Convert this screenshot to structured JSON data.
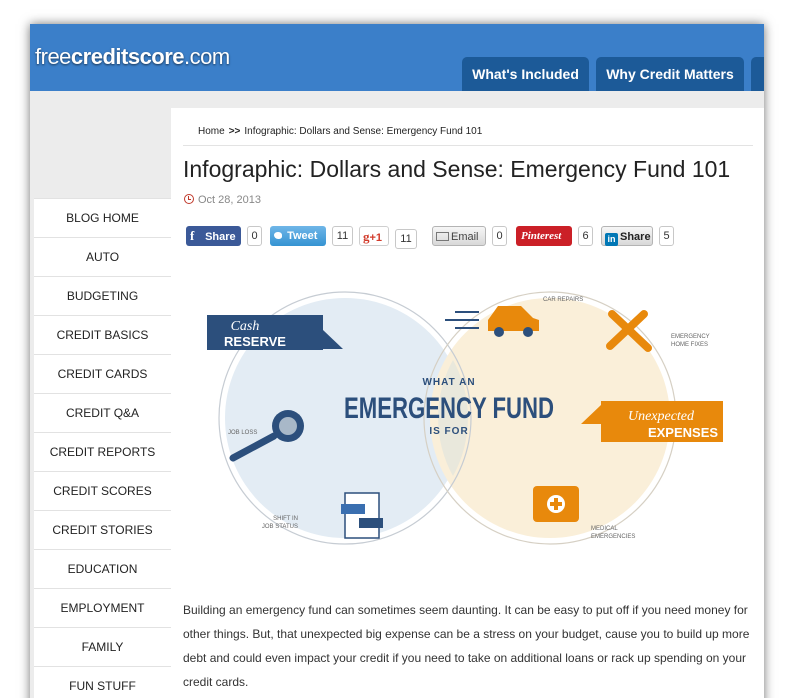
{
  "header": {
    "logo_pre": "free",
    "logo_bold": "creditscore",
    "logo_post": ".com",
    "tabs": [
      {
        "label": "What's Included"
      },
      {
        "label": "Why Credit Matters"
      }
    ]
  },
  "breadcrumb": {
    "home": "Home",
    "separator": ">>",
    "current": "Infographic: Dollars and Sense: Emergency Fund 101"
  },
  "article": {
    "title": "Infographic: Dollars and Sense: Emergency Fund 101",
    "date": "Oct 28, 2013",
    "body": "Building an emergency fund can sometimes seem daunting. It can be easy to put off if you need money for other things. But, that unexpected big expense can be a stress on your budget, cause you to build up more debt and could even impact your credit if you need to take on additional loans or rack up spending on your credit cards."
  },
  "share": {
    "facebook": {
      "label": "Share",
      "count": "0"
    },
    "twitter": {
      "label": "Tweet",
      "count": "11"
    },
    "gplus": {
      "label": "+1",
      "count": "11"
    },
    "email": {
      "label": "Email",
      "count": "0"
    },
    "pinterest": {
      "label": "Pinterest",
      "count": "6"
    },
    "linkedin": {
      "label": "Share",
      "count": "5"
    }
  },
  "infographic": {
    "cash_1": "Cash",
    "cash_2": "RESERVE",
    "what_an": "WHAT AN",
    "emergency_fund": "EMERGENCY FUND",
    "is_for": "IS FOR",
    "car_repairs": "CAR REPAIRS",
    "emergency_1": "EMERGENCY",
    "home_fixes": "HOME FIXES",
    "unexpected": "Unexpected",
    "expenses": "EXPENSES",
    "medical": "MEDICAL",
    "emergencies": "EMERGENCIES",
    "job_loss": "JOB LOSS",
    "shift_in": "SHIFT IN",
    "job_status": "JOB STATUS"
  },
  "sidebar": {
    "items": [
      {
        "label": "BLOG HOME"
      },
      {
        "label": "AUTO"
      },
      {
        "label": "BUDGETING"
      },
      {
        "label": "CREDIT BASICS"
      },
      {
        "label": "CREDIT CARDS"
      },
      {
        "label": "CREDIT Q&A"
      },
      {
        "label": "CREDIT REPORTS"
      },
      {
        "label": "CREDIT SCORES"
      },
      {
        "label": "CREDIT STORIES"
      },
      {
        "label": "EDUCATION"
      },
      {
        "label": "EMPLOYMENT"
      },
      {
        "label": "FAMILY"
      },
      {
        "label": "FUN STUFF"
      }
    ]
  },
  "colors": {
    "header_blue": "#3b7fc9",
    "tab_navy": "#1c5a98",
    "infographic_navy": "#2c4f7c",
    "infographic_orange": "#e8890c"
  }
}
